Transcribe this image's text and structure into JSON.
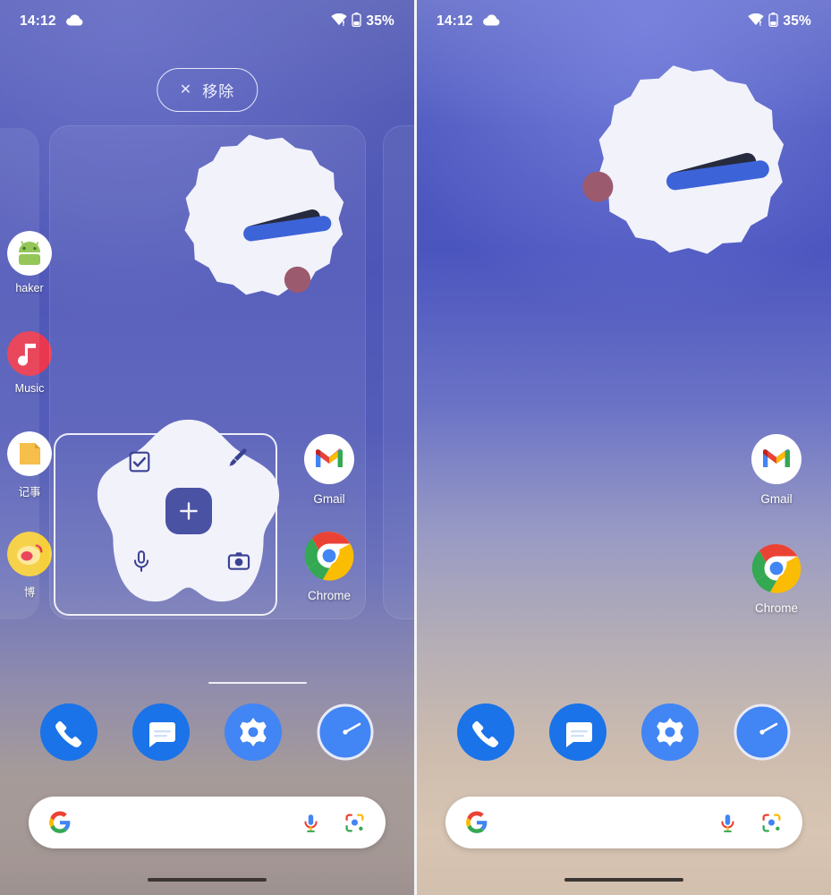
{
  "screens": [
    {
      "id": "left-drag-mode",
      "status_bar": {
        "time": "14:12",
        "weather_icon": "cloud-icon",
        "wifi_icon": "wifi-warning-icon",
        "battery_icon": "battery-icon",
        "battery_level": "35%"
      },
      "drag_mode": true,
      "remove_button": {
        "label": "移除",
        "icon": "close-icon"
      },
      "peek_apps": [
        {
          "label": "haker",
          "icon": "android-shaker-icon",
          "color": "#ffffff"
        },
        {
          "label": "Music",
          "icon": "netease-music-icon",
          "color": "#e8384f"
        },
        {
          "label": "记事",
          "icon": "notes-icon",
          "color": "#f6b93b"
        },
        {
          "label": "博",
          "icon": "weibo-icon",
          "color": "#f5c518"
        }
      ],
      "clock_widget": {
        "name": "analog-clock-widget",
        "hour_angle": 75,
        "minute_angle": 72,
        "second_dot_angle": 145,
        "face_color": "#f2f2fb",
        "hand_color": "#3d63d8",
        "hour_hand_color": "#262b3e",
        "second_color": "#9c5a6e"
      },
      "keep_widget": {
        "name": "google-keep-widget",
        "blob_color": "#f2f2fb",
        "accent": "#4a52a3",
        "actions": [
          "checkbox-icon",
          "brush-icon",
          "mic-icon",
          "camera-icon"
        ],
        "primary_action": "add-note-plus-icon"
      },
      "apps": [
        {
          "label": "Gmail",
          "icon": "gmail-icon"
        },
        {
          "label": "Chrome",
          "icon": "chrome-icon"
        }
      ],
      "page_indicator": true,
      "dock": [
        {
          "label": "Phone",
          "icon": "phone-icon"
        },
        {
          "label": "Messages",
          "icon": "messages-icon"
        },
        {
          "label": "Settings",
          "icon": "settings-gear-icon"
        },
        {
          "label": "Clock",
          "icon": "clock-icon"
        }
      ],
      "search": {
        "placeholder": "",
        "value": "",
        "logo": "google-g-icon",
        "mic": "mic-icon",
        "lens": "google-lens-icon"
      }
    },
    {
      "id": "right-normal",
      "status_bar": {
        "time": "14:12",
        "weather_icon": "cloud-icon",
        "wifi_icon": "wifi-warning-icon",
        "battery_icon": "battery-icon",
        "battery_level": "35%"
      },
      "drag_mode": false,
      "clock_widget": {
        "name": "analog-clock-widget",
        "hour_angle": 75,
        "minute_angle": 72,
        "second_dot_angle": 262,
        "face_color": "#f2f2fb",
        "hand_color": "#3d63d8",
        "hour_hand_color": "#262b3e",
        "second_color": "#9c5a6e"
      },
      "apps": [
        {
          "label": "Gmail",
          "icon": "gmail-icon"
        },
        {
          "label": "Chrome",
          "icon": "chrome-icon"
        }
      ],
      "page_indicator": false,
      "dock": [
        {
          "label": "Phone",
          "icon": "phone-icon"
        },
        {
          "label": "Messages",
          "icon": "messages-icon"
        },
        {
          "label": "Settings",
          "icon": "settings-gear-icon"
        },
        {
          "label": "Clock",
          "icon": "clock-icon"
        }
      ],
      "search": {
        "placeholder": "",
        "value": "",
        "logo": "google-g-icon",
        "mic": "mic-icon",
        "lens": "google-lens-icon"
      }
    }
  ],
  "colors": {
    "accent_blue": "#1a73e8",
    "keep_accent": "#4a52a3",
    "clock_hand": "#3d63d8",
    "second_dot": "#9c5a6e",
    "widget_face": "#f2f2fb"
  }
}
